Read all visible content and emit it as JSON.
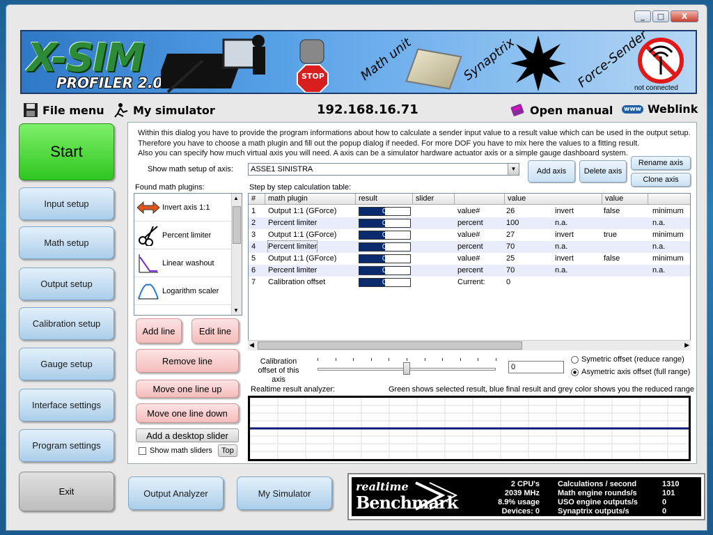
{
  "window": {
    "minimize": "_",
    "maximize": "□",
    "close": "X"
  },
  "banner": {
    "logo": "X-SIM",
    "product": "PROFILER 2.0",
    "stop_sign": "STOP",
    "math_unit": "Math unit",
    "synaptrix": "Synaptrix",
    "force_sender": "Force-Sender",
    "connection_status": "not connected"
  },
  "menu": {
    "file_menu": "File menu",
    "my_simulator": "My simulator",
    "ip_address": "192.168.16.71",
    "open_manual": "Open manual",
    "weblink": "Weblink",
    "www_icon": "www"
  },
  "sidebar": {
    "start": "Start",
    "items": [
      {
        "label": "Input setup"
      },
      {
        "label": "Math setup"
      },
      {
        "label": "Output setup"
      },
      {
        "label": "Calibration setup"
      },
      {
        "label": "Gauge setup"
      },
      {
        "label": "Interface settings"
      },
      {
        "label": "Program settings"
      }
    ],
    "exit": "Exit"
  },
  "bottom_buttons": {
    "output_analyzer": "Output Analyzer",
    "my_simulator": "My Simulator"
  },
  "panel": {
    "description": [
      "Within this dialog you have to provide the program informations about how to calculate a sender input value to a result value which can be used in the output setup.",
      "Therefore you have to choose a math plugin and fill out the popup dialog if needed. For more DOF you have to mix here the values to a fitting result.",
      "Also you can specify how much virtual axis you will need. A axis can be a simulator hardware actuator axis or a simple gauge dashboard system."
    ],
    "axis_label": "Show math setup of axis:",
    "axis_value": "ASSE1 SINISTRA",
    "add_axis": "Add axis",
    "delete_axis": "Delete axis",
    "rename_axis": "Rename axis",
    "clone_axis": "Clone axis",
    "found_plugins_label": "Found math plugins:",
    "step_table_label": "Step by step calculation table:",
    "plugins": [
      {
        "name": "Invert axis 1:1"
      },
      {
        "name": "Percent limiter"
      },
      {
        "name": "Linear washout"
      },
      {
        "name": "Logarithm scaler"
      }
    ],
    "add_line": "Add line",
    "edit_line": "Edit line",
    "remove_line": "Remove line",
    "move_up": "Move one line up",
    "move_down": "Move one line down",
    "add_desktop_slider": "Add a desktop slider",
    "show_math_sliders": "Show math sliders",
    "top": "Top",
    "table": {
      "headers": [
        "#",
        "math plugin",
        "result",
        "slider",
        "",
        "value",
        "",
        "value",
        ""
      ],
      "rows": [
        {
          "n": "1",
          "plugin": "Output 1:1 (GForce)",
          "res": "0",
          "fill": 0.5,
          "a": "value#",
          "b": "26",
          "c": "invert",
          "d": "false",
          "e": "minimum"
        },
        {
          "n": "2",
          "plugin": "Percent limiter",
          "res": "0",
          "fill": 0.5,
          "a": "percent",
          "b": "100",
          "c": "n.a.",
          "d": "",
          "e": "n.a."
        },
        {
          "n": "3",
          "plugin": "Output 1:1 (GForce)",
          "res": "0",
          "fill": 0.5,
          "a": "value#",
          "b": "27",
          "c": "invert",
          "d": "true",
          "e": "minimum"
        },
        {
          "n": "4",
          "plugin": "Percent limiter",
          "res": "0",
          "fill": 0.5,
          "a": "percent",
          "b": "70",
          "c": "n.a.",
          "d": "",
          "e": "n.a."
        },
        {
          "n": "5",
          "plugin": "Output 1:1 (GForce)",
          "res": "0",
          "fill": 0.5,
          "a": "value#",
          "b": "25",
          "c": "invert",
          "d": "false",
          "e": "minimum"
        },
        {
          "n": "6",
          "plugin": "Percent limiter",
          "res": "0",
          "fill": 0.5,
          "a": "percent",
          "b": "70",
          "c": "n.a.",
          "d": "",
          "e": "n.a."
        },
        {
          "n": "7",
          "plugin": "Calibration offset",
          "res": "0",
          "fill": 0.5,
          "a": "Current:",
          "b": "0",
          "c": "",
          "d": "",
          "e": ""
        }
      ]
    },
    "calibration_label": "Calibration offset of this axis",
    "calibration_value": "0",
    "calibration_slider_level": 0.5,
    "radio_symmetric": "Symetric offset (reduce range)",
    "radio_asymmetric": "Asymetric axis offset (full range)",
    "analyzer_label": "Realtime result analyzer:",
    "analyzer_hint": "Green shows selected result, blue final result and grey color shows you the reduced range"
  },
  "benchmark": {
    "title_top": "realtime",
    "title_bottom": "Benchmark",
    "cpus": "2 CPU's",
    "mhz": "2039 MHz",
    "usage": "8.9% usage",
    "devices": "Devices: 0",
    "stats": [
      {
        "label": "Calculations / second",
        "value": "1310"
      },
      {
        "label": "Math engine rounds/s",
        "value": "101"
      },
      {
        "label": "USO engine outputs/s",
        "value": "0"
      },
      {
        "label": "Synaptrix outputs/s",
        "value": "0"
      }
    ]
  },
  "colors": {
    "start_green": "#2fc61f",
    "banner_blue": "#5aa2e8",
    "result_bar": "#0b2a6e",
    "analyzer_line": "#0b1a7a"
  }
}
